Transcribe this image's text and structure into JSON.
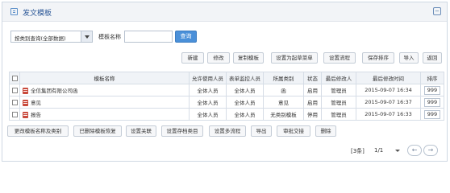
{
  "header": {
    "title": "发文模板"
  },
  "search": {
    "filter_value": "按类别查询(全部数据)",
    "name_label": "模板名称",
    "name_value": "",
    "query_label": "查询"
  },
  "toolbar": {
    "new": "新建",
    "edit": "修改",
    "copy": "复制模板",
    "set_start": "设置为起草菜单",
    "set_flow": "设置流程",
    "save_sort": "保存排序",
    "import": "导入",
    "back": "返回"
  },
  "table": {
    "headers": [
      "模板名称",
      "允许使用人员",
      "表单监控人员",
      "所属类别",
      "状态",
      "最后修改人",
      "最后修改时间",
      "排序"
    ],
    "rows": [
      {
        "name": "全信集团有限公司函",
        "users": "全体人员",
        "monitors": "全体人员",
        "category": "函",
        "status": "启用",
        "modifier": "管理员",
        "time": "2015-09-07 16:34",
        "sort": "999"
      },
      {
        "name": "意见",
        "users": "全体人员",
        "monitors": "全体人员",
        "category": "意见",
        "status": "启用",
        "modifier": "管理员",
        "time": "2015-09-07 16:37",
        "sort": "999"
      },
      {
        "name": "报告",
        "users": "全体人员",
        "monitors": "全体人员",
        "category": "无类别模板",
        "status": "停用",
        "modifier": "管理员",
        "time": "2015-09-07 16:33",
        "sort": "999"
      }
    ]
  },
  "bottom": {
    "rename": "更改模板名称及类别",
    "deleted": "已删除模板恢复",
    "link": "设置关联",
    "archive": "设置存档类目",
    "multi_flow": "设置多流程",
    "export": "导出",
    "approve": "审批交接",
    "delete": "删除"
  },
  "pager": {
    "count": "[3条]",
    "page": "1/1"
  }
}
